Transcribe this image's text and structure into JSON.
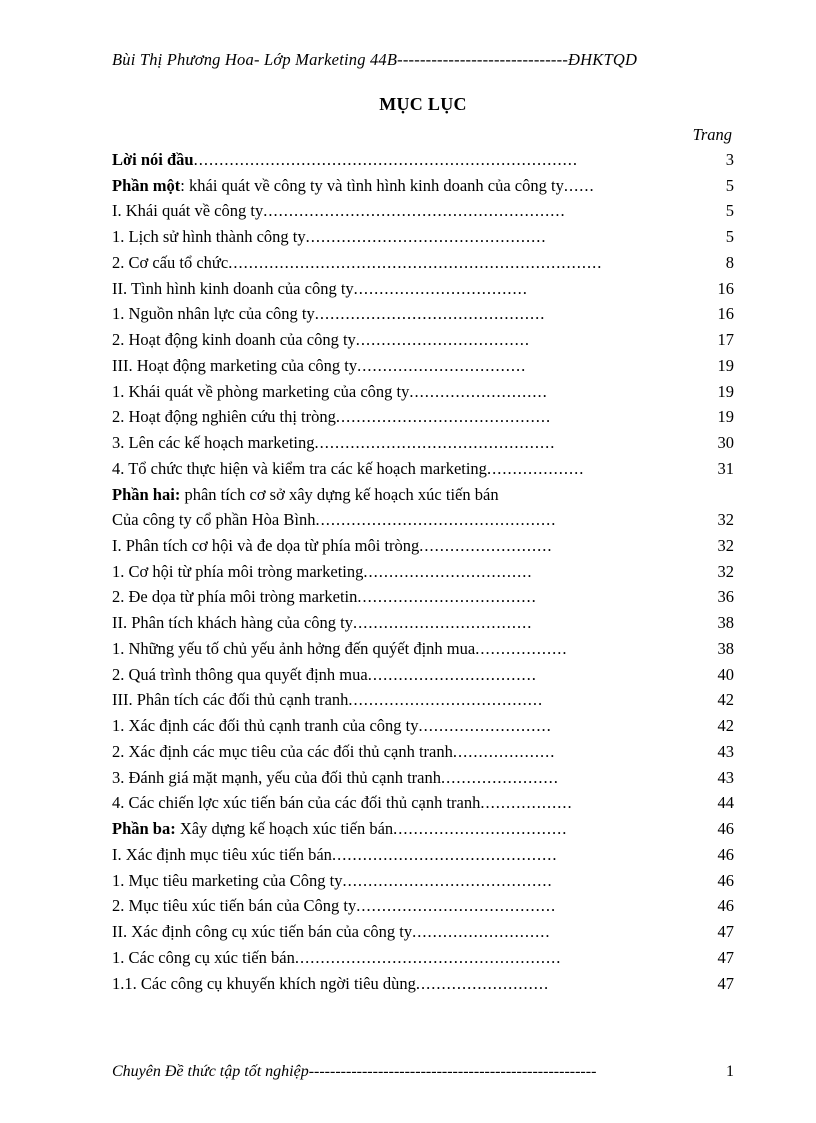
{
  "header": {
    "left": "Bùi Thị Phương   Hoa- Lớp Marketing 44B",
    "dashes": "------------------------------",
    "right": "ĐHKTQD"
  },
  "title": "MỤC LỤC",
  "page_label": "Trang",
  "toc": [
    {
      "bold": "Lời nói đầu",
      "text": "",
      "dots": "...........................................................................",
      "page": "3"
    },
    {
      "bold": "Phần một",
      "text": ": khái quát về công ty và tình hình kinh doanh của công ty",
      "dots": "......",
      "page": "5"
    },
    {
      "bold": "",
      "text": "I. Khái quát về công ty",
      "dots": "...........................................................",
      "page": "5"
    },
    {
      "bold": "",
      "text": "1. Lịch sử hình thành công ty",
      "dots": "...............................................",
      "page": "5"
    },
    {
      "bold": "",
      "text": "2. Cơ cấu tổ chức",
      "dots": ".........................................................................",
      "page": "8"
    },
    {
      "bold": "",
      "text": "II. Tình hình kinh doanh của công ty ",
      "dots": "..................................",
      "page": "16"
    },
    {
      "bold": "",
      "text": "1. Nguồn nhân lực của công ty",
      "dots": ".............................................",
      "page": "16"
    },
    {
      "bold": "",
      "text": "2. Hoạt động kinh doanh của công ty",
      "dots": "..................................",
      "page": "17"
    },
    {
      "bold": "",
      "text": "III. Hoạt động marketing của công ty",
      "dots": ".................................",
      "page": "19"
    },
    {
      "bold": "",
      "text": "1. Khái quát về phòng marketing của công ty",
      "dots": "...........................",
      "page": "19"
    },
    {
      "bold": "",
      "text": "2. Hoạt động nghiên cứu thị tròng",
      "dots": "..........................................",
      "page": "19"
    },
    {
      "bold": "",
      "text": "3. Lên các kế hoạch marketing",
      "dots": "...............................................",
      "page": "30"
    },
    {
      "bold": "",
      "text": "4. Tổ chức thực hiện và kiểm tra các kế hoạch marketing",
      "dots": "...................",
      "page": "31"
    },
    {
      "bold": "Phần hai:",
      "text": " phân tích cơ sở xây dựng kế hoạch xúc tiến bán",
      "dots": "",
      "page": ""
    },
    {
      "bold": "",
      "text": "Của công ty cổ phần Hòa Bình",
      "dots": "...............................................",
      "page": "32"
    },
    {
      "bold": "",
      "text": "I. Phân tích cơ hội và đe dọa từ phía môi tròng",
      "dots": "..........................",
      "page": "32"
    },
    {
      "bold": "",
      "text": "1. Cơ hội từ phía môi tròng    marketing",
      "dots": ".................................",
      "page": "32"
    },
    {
      "bold": "",
      "text": "2. Đe dọa từ phía môi tròng    marketin",
      "dots": "...................................",
      "page": "36"
    },
    {
      "bold": "",
      "text": "II. Phân tích khách hàng của công ty",
      "dots": "...................................",
      "page": "38"
    },
    {
      "bold": "",
      "text": "1. Những yếu tố chủ yếu ảnh hởng   đến quýết định mua",
      "dots": "..................",
      "page": "38"
    },
    {
      "bold": "",
      "text": "2. Quá trình thông qua quyết định mua",
      "dots": ".................................",
      "page": "40"
    },
    {
      "bold": "",
      "text": "III. Phân tích các đối thủ cạnh tranh",
      "dots": "......................................",
      "page": "42"
    },
    {
      "bold": "",
      "text": "1. Xác định các đối thủ cạnh tranh của công ty",
      "dots": "..........................",
      "page": "42"
    },
    {
      "bold": "",
      "text": "2. Xác định các mục tiêu của các đối thủ cạnh tranh",
      "dots": "....................",
      "page": "43"
    },
    {
      "bold": "",
      "text": "3. Đánh giá mặt mạnh, yếu của đối thủ cạnh tranh",
      "dots": ".......................",
      "page": "43"
    },
    {
      "bold": "",
      "text": "4. Các chiến lợc   xúc tiến bán của các đối thủ cạnh tranh",
      "dots": "..................",
      "page": "44"
    },
    {
      "bold": "Phần ba:",
      "text": " Xây dựng kế hoạch xúc tiến bán",
      "dots": "..................................",
      "page": "46"
    },
    {
      "bold": "",
      "text": "I. Xác định mục tiêu xúc tiến bán",
      "dots": "............................................",
      "page": "46"
    },
    {
      "bold": "",
      "text": "1. Mục tiêu marketing của Công ty",
      "dots": ".........................................",
      "page": "46"
    },
    {
      "bold": "",
      "text": "2. Mục tiêu xúc tiến bán của Công ty",
      "dots": ".......................................",
      "page": "46"
    },
    {
      "bold": "",
      "text": "II. Xác định công cụ xúc tiến bán của công ty",
      "dots": "...........................",
      "page": "47"
    },
    {
      "bold": "",
      "text": "1. Các công cụ xúc tiến bán",
      "dots": "....................................................",
      "page": "47"
    },
    {
      "bold": "",
      "text": "1.1. Các công cụ khuyến khích ngời   tiêu dùng",
      "dots": "..........................",
      "page": "47"
    }
  ],
  "footer": {
    "text": "Chuyên Đề thức tập tốt nghiệp",
    "dashes": "------------------------------------------------------",
    "page": "1"
  }
}
